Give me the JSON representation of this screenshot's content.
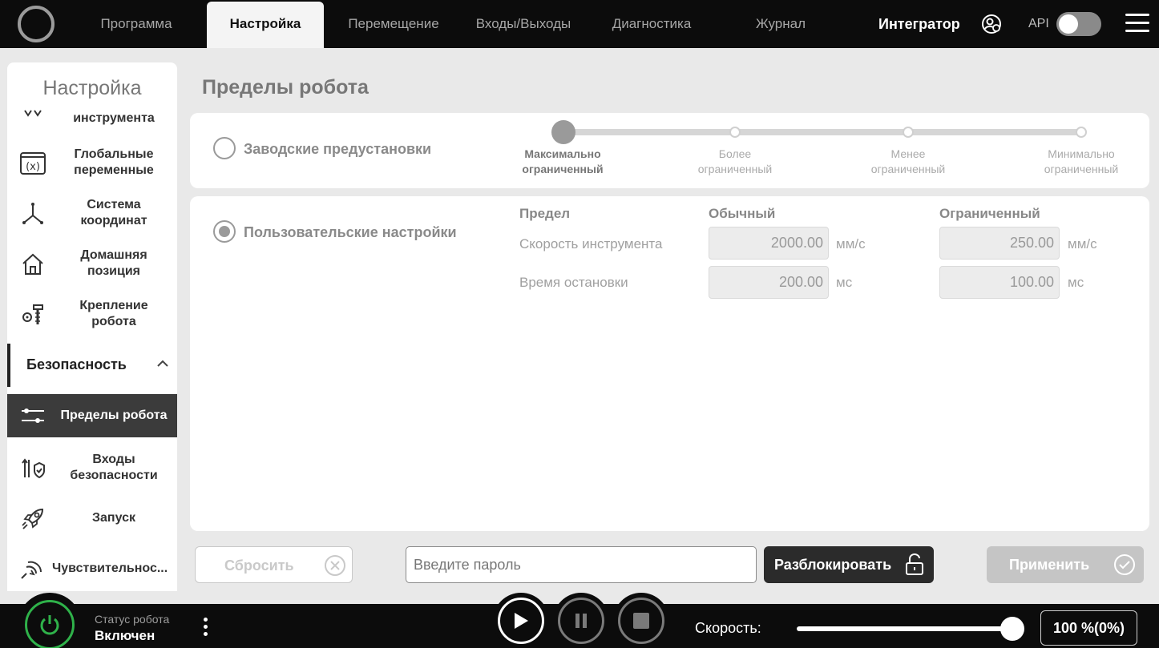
{
  "topbar": {
    "tabs": [
      {
        "label": "Программа"
      },
      {
        "label": "Настройка"
      },
      {
        "label": "Перемещение"
      },
      {
        "label": "Входы/Выходы"
      },
      {
        "label": "Диагностика"
      },
      {
        "label": "Журнал"
      }
    ],
    "active_tab": "Настройка",
    "user_role": "Интегратор",
    "api_label": "API",
    "api_enabled": false
  },
  "sidebar": {
    "title": "Настройка",
    "items": [
      {
        "label": "инструмента",
        "icon": "tool-icon"
      },
      {
        "label": "Глобальные переменные",
        "icon": "variable-icon"
      },
      {
        "label": "Система координат",
        "icon": "axes-icon"
      },
      {
        "label": "Домашняя позиция",
        "icon": "home-icon"
      },
      {
        "label": "Крепление робота",
        "icon": "mount-icon"
      }
    ],
    "section": {
      "label": "Безопасность",
      "expanded": true
    },
    "sub_items": [
      {
        "label": "Пределы робота",
        "icon": "sliders-icon",
        "active": true
      },
      {
        "label": "Входы безопасности",
        "icon": "safety-io-icon"
      },
      {
        "label": "Запуск",
        "icon": "rocket-icon"
      },
      {
        "label": "Чувствительнос...",
        "icon": "sensitivity-icon"
      }
    ]
  },
  "main": {
    "title": "Пределы робота",
    "preset": {
      "label": "Заводские предустановки",
      "selected": false,
      "steps": [
        {
          "line1": "Максимально",
          "line2": "ограниченный",
          "selected": true
        },
        {
          "line1": "Более",
          "line2": "ограниченный"
        },
        {
          "line1": "Менее",
          "line2": "ограниченный"
        },
        {
          "line1": "Минимально",
          "line2": "ограниченный"
        }
      ]
    },
    "custom": {
      "label": "Пользовательские настройки",
      "selected": true,
      "headers": {
        "limit": "Предел",
        "normal": "Обычный",
        "reduced": "Ограниченный"
      },
      "rows": [
        {
          "label": "Скорость инструмента",
          "normal": "2000.00",
          "normal_unit": "мм/с",
          "reduced": "250.00",
          "reduced_unit": "мм/с"
        },
        {
          "label": "Время остановки",
          "normal": "200.00",
          "normal_unit": "мс",
          "reduced": "100.00",
          "reduced_unit": "мс"
        }
      ]
    }
  },
  "actions": {
    "reset_label": "Сбросить",
    "password_placeholder": "Введите пароль",
    "unlock_label": "Разблокировать",
    "apply_label": "Применить"
  },
  "bottombar": {
    "status_caption": "Статус робота",
    "status_value": "Включен",
    "speed_label": "Скорость:",
    "speed_value": "100 %(0%)",
    "speed_fraction": 1.0
  },
  "colors": {
    "bar_bg": "#0c0c0c",
    "power_green": "#2fb24a",
    "active_item": "#3b3b3b"
  }
}
